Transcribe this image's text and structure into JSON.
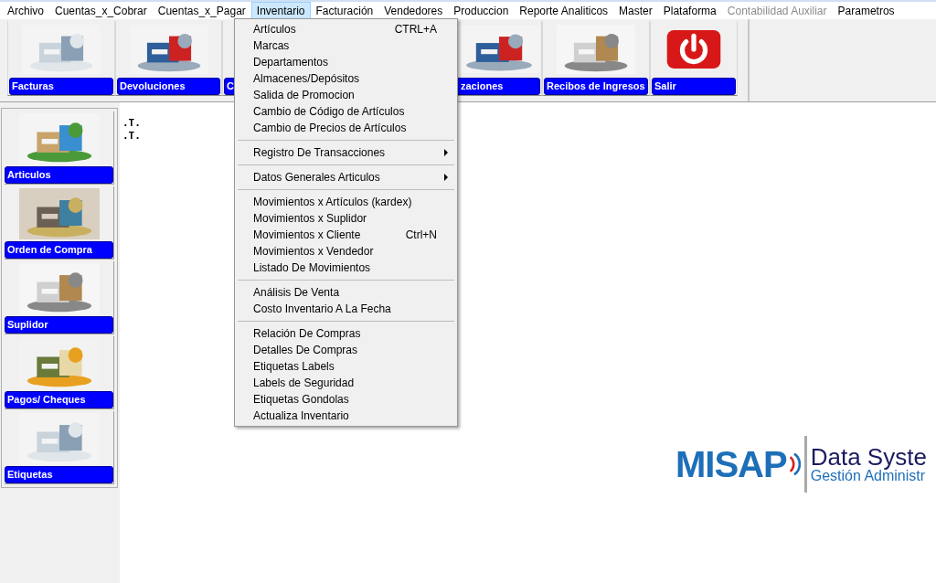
{
  "menu_bar": [
    {
      "label": "Archivo",
      "selected": false,
      "disabled": false
    },
    {
      "label": "Cuentas_x_Cobrar",
      "selected": false,
      "disabled": false
    },
    {
      "label": "Cuentas_x_Pagar",
      "selected": false,
      "disabled": false
    },
    {
      "label": "Inventario",
      "selected": true,
      "disabled": false
    },
    {
      "label": "Facturación",
      "selected": false,
      "disabled": false
    },
    {
      "label": "Vendedores",
      "selected": false,
      "disabled": false
    },
    {
      "label": "Produccion",
      "selected": false,
      "disabled": false
    },
    {
      "label": "Reporte Analiticos",
      "selected": false,
      "disabled": false
    },
    {
      "label": "Master",
      "selected": false,
      "disabled": false
    },
    {
      "label": "Plataforma",
      "selected": false,
      "disabled": false
    },
    {
      "label": "Contabilidad Auxiliar",
      "selected": false,
      "disabled": true
    },
    {
      "label": "Parametros",
      "selected": false,
      "disabled": false
    }
  ],
  "toolbar": [
    {
      "label": "Facturas",
      "kind": "picture"
    },
    {
      "label": "Devoluciones",
      "kind": "picture"
    },
    {
      "label": "C",
      "kind": "hidden"
    },
    {
      "label": "zaciones",
      "kind": "clipped"
    },
    {
      "label": "Recibos de Ingresos",
      "kind": "picture"
    },
    {
      "label": "Salir",
      "kind": "power"
    }
  ],
  "dropdown_menu": [
    {
      "kind": "item",
      "label": "Artículos",
      "shortcut": "CTRL+A"
    },
    {
      "kind": "item",
      "label": "Marcas"
    },
    {
      "kind": "item",
      "label": "Departamentos"
    },
    {
      "kind": "item",
      "label": "Almacenes/Depósitos"
    },
    {
      "kind": "item",
      "label": "Salida de Promocion"
    },
    {
      "kind": "item",
      "label": "Cambio de Código de Artículos"
    },
    {
      "kind": "item",
      "label": "Cambio de Precios de Artículos"
    },
    {
      "kind": "separator"
    },
    {
      "kind": "submenu",
      "label": "Registro De Transacciones"
    },
    {
      "kind": "separator"
    },
    {
      "kind": "submenu",
      "label": "Datos Generales Articulos"
    },
    {
      "kind": "separator"
    },
    {
      "kind": "item",
      "label": "Movimientos x Artículos (kardex)"
    },
    {
      "kind": "item",
      "label": "Movimientos x Suplidor"
    },
    {
      "kind": "item",
      "label": "Movimientos x Cliente",
      "shortcut": "Ctrl+N"
    },
    {
      "kind": "item",
      "label": "Movimientos x Vendedor"
    },
    {
      "kind": "item",
      "label": "Listado De Movimientos"
    },
    {
      "kind": "separator"
    },
    {
      "kind": "item",
      "label": "Análisis De Venta"
    },
    {
      "kind": "item",
      "label": "Costo Inventario A La Fecha"
    },
    {
      "kind": "separator"
    },
    {
      "kind": "item",
      "label": "Relación De Compras"
    },
    {
      "kind": "item",
      "label": "Detalles De Compras"
    },
    {
      "kind": "item",
      "label": "Etiquetas Labels"
    },
    {
      "kind": "item",
      "label": "Labels de Seguridad"
    },
    {
      "kind": "item",
      "label": "Etiquetas Gondolas"
    },
    {
      "kind": "item",
      "label": "Actualiza Inventario"
    }
  ],
  "sidebar": [
    {
      "label": "Articulos"
    },
    {
      "label": "Orden de Compra"
    },
    {
      "label": "Suplidor"
    },
    {
      "label": "Pagos/ Cheques"
    },
    {
      "label": "Etiquetas"
    }
  ],
  "content_lines": [
    ".T.",
    ".T."
  ],
  "logo": {
    "brand": "MISAP",
    "title": "Data Syste",
    "subtitle": "Gestión Administr"
  }
}
